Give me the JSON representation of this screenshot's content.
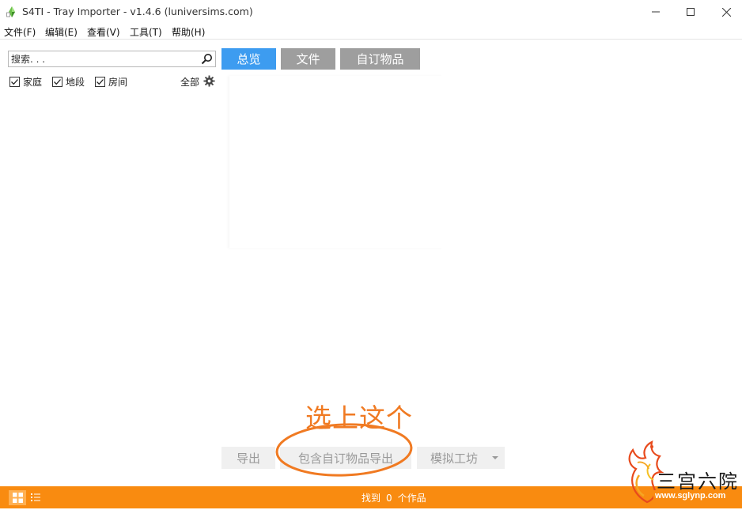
{
  "window": {
    "title": "S4TI - Tray Importer - v1.4.6  (luniversims.com)"
  },
  "menu": {
    "items": [
      "文件(F)",
      "编辑(E)",
      "查看(V)",
      "工具(T)",
      "帮助(H)"
    ]
  },
  "search": {
    "placeholder": "搜索. . ."
  },
  "filters": {
    "items": [
      {
        "label": "家庭",
        "checked": true
      },
      {
        "label": "地段",
        "checked": true
      },
      {
        "label": "房间",
        "checked": true
      }
    ],
    "all_label": "全部"
  },
  "tabs": [
    {
      "label": "总览",
      "active": true
    },
    {
      "label": "文件",
      "active": false
    },
    {
      "label": "自订物品",
      "active": false
    }
  ],
  "annotation": {
    "text": "选上这个"
  },
  "actions": {
    "export": "导出",
    "export_with_cc": "包含自订物品导出",
    "studio": "模拟工坊"
  },
  "status": {
    "prefix": "找到",
    "count": "0",
    "suffix": "个作品"
  },
  "watermark": {
    "text": "三宫六院",
    "url": "www.sglynp.com"
  },
  "colors": {
    "accent": "#3d9cf0",
    "tab_inactive": "#9e9e9e",
    "statusbar": "#f98b10",
    "annotation": "#f07a22"
  }
}
